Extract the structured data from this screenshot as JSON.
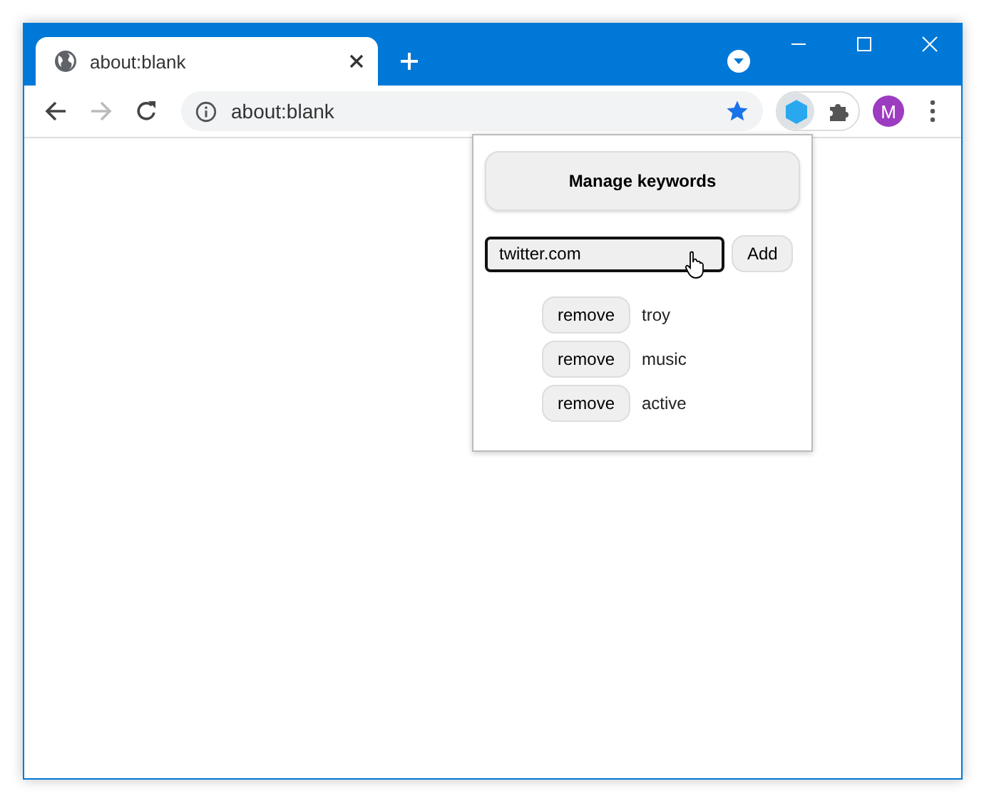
{
  "tab": {
    "title": "about:blank",
    "selected": true
  },
  "toolbar": {
    "address": "about:blank",
    "bookmarked": true,
    "avatar_letter": "M"
  },
  "popup": {
    "title_button": "Manage keywords",
    "input": {
      "value": "twitter.com"
    },
    "add_button": "Add",
    "keywords": [
      {
        "remove_label": "remove",
        "keyword": "troy"
      },
      {
        "remove_label": "remove",
        "keyword": "music"
      },
      {
        "remove_label": "remove",
        "keyword": "active"
      }
    ]
  }
}
